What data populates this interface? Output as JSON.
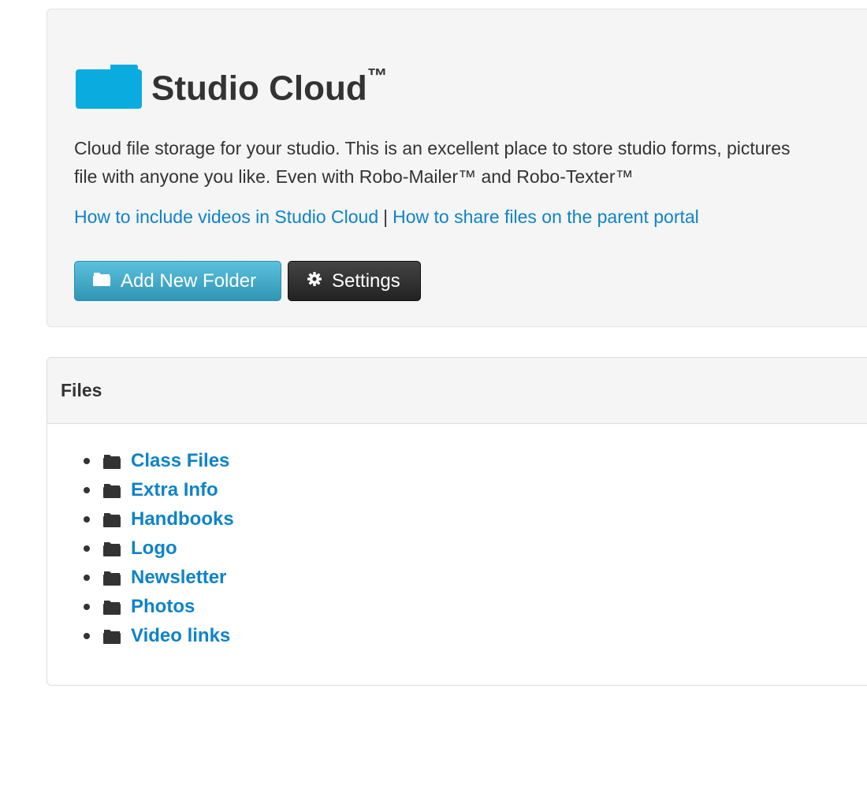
{
  "header": {
    "title": "Studio Cloud",
    "title_mark": "™",
    "description_line1": "Cloud file storage for your studio. This is an excellent place to store studio forms, pictures",
    "description_line2": "file with anyone you like. Even with Robo-Mailer™ and Robo-Texter™",
    "links": [
      {
        "label": "How to include videos in Studio Cloud"
      },
      {
        "label": "How to share files on the parent portal"
      }
    ],
    "link_separator": "|",
    "buttons": {
      "add_folder": "Add New Folder",
      "settings": "Settings"
    },
    "icons": {
      "title": "folder-icon",
      "add_folder": "folder-icon",
      "settings": "gear-icon"
    }
  },
  "files_panel": {
    "title": "Files",
    "items": [
      {
        "label": "Class Files",
        "icon": "folder-icon"
      },
      {
        "label": "Extra Info",
        "icon": "folder-icon"
      },
      {
        "label": "Handbooks",
        "icon": "folder-icon"
      },
      {
        "label": "Logo",
        "icon": "folder-icon"
      },
      {
        "label": "Newsletter",
        "icon": "folder-icon"
      },
      {
        "label": "Photos",
        "icon": "folder-icon"
      },
      {
        "label": "Video links",
        "icon": "folder-icon"
      }
    ]
  },
  "colors": {
    "accent": "#0e83c8",
    "folder_blue": "#0aace0",
    "primary_button": "#49afcd",
    "dark_button": "#333333",
    "panel_background": "#f5f5f5"
  }
}
